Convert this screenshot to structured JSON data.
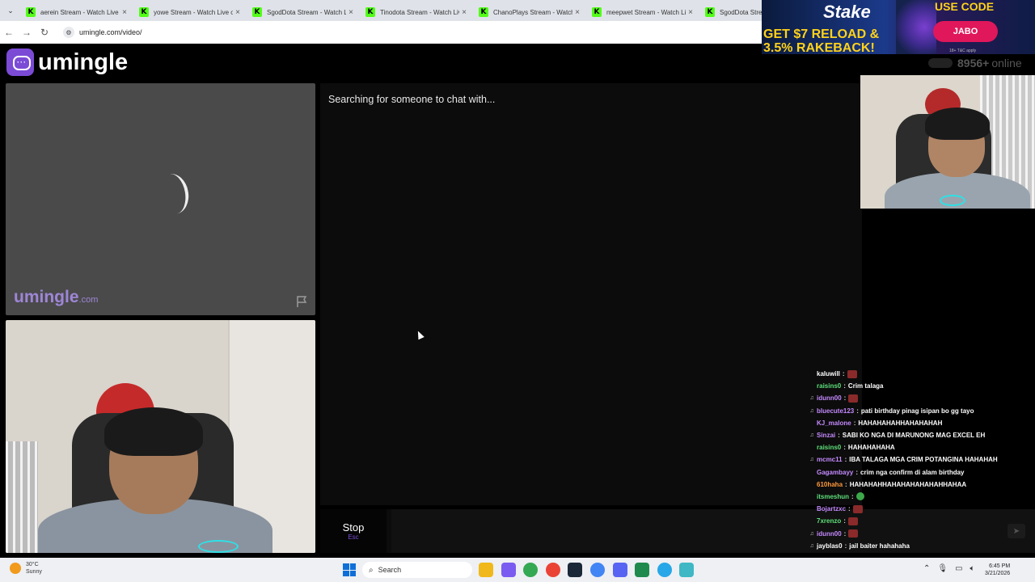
{
  "browser": {
    "tabs": [
      {
        "title": "aerein Stream - Watch Live o"
      },
      {
        "title": "yowe Stream - Watch Live on"
      },
      {
        "title": "SgodDota Stream - Watch Li"
      },
      {
        "title": "Tinodota Stream - Watch Liv"
      },
      {
        "title": "ChanoPlays Stream - Watch"
      },
      {
        "title": "meepwet Stream - Watch Li"
      },
      {
        "title": "SgodDota Stream"
      }
    ],
    "url": "umingle.com/video/"
  },
  "ad": {
    "brand": "Stake",
    "headline_1": "GET $7 RELOAD &",
    "headline_2": "3.5% RAKEBACK!",
    "use_code_label": "USE CODE",
    "code": "JABO",
    "fine_print": "18+ T&C apply"
  },
  "header": {
    "logo_text": "umingle",
    "online_count": "8956+",
    "online_label": "online"
  },
  "stranger_panel": {
    "watermark": "umingle",
    "watermark_suffix": ".com"
  },
  "chat": {
    "status": "Searching for someone to chat with...",
    "stop_label": "Stop",
    "stop_key": "Esc"
  },
  "stream_chat": [
    {
      "user": "kaluwill",
      "color": "#ffffff",
      "message": "",
      "emote": "red",
      "badge": ""
    },
    {
      "user": "raisins0",
      "color": "#5ee07a",
      "message": "Crim talaga",
      "emote": "",
      "badge": ""
    },
    {
      "user": "idunn00",
      "color": "#c58aff",
      "message": "",
      "emote": "red",
      "badge": "♫"
    },
    {
      "user": "bluecute123",
      "color": "#c58aff",
      "message": "pati birthday pinag isipan bo gg tayo",
      "emote": "",
      "badge": "♫"
    },
    {
      "user": "KJ_malone",
      "color": "#c58aff",
      "message": "HAHAHAHAHHAHAHAHAH",
      "emote": "",
      "badge": ""
    },
    {
      "user": "Sinzai",
      "color": "#c58aff",
      "message": "SABI KO NGA DI MARUNONG MAG EXCEL EH",
      "emote": "",
      "badge": "♫"
    },
    {
      "user": "raisins0",
      "color": "#5ee07a",
      "message": "HAHAHAHAHA",
      "emote": "",
      "badge": ""
    },
    {
      "user": "mcmc11",
      "color": "#c58aff",
      "message": "IBA TALAGA MGA CRIM POTANGINA HAHAHAH",
      "emote": "",
      "badge": "♫"
    },
    {
      "user": "Gagambayy",
      "color": "#c58aff",
      "message": "crim nga confirm di alam birthday",
      "emote": "",
      "badge": ""
    },
    {
      "user": "610haha",
      "color": "#ff9a3c",
      "message": "HAHAHAHHAHAHAHAHAHAHHAHAA",
      "emote": "",
      "badge": ""
    },
    {
      "user": "itsmeshun",
      "color": "#5ee07a",
      "message": "",
      "emote": "green",
      "badge": ""
    },
    {
      "user": "Bojartzxc",
      "color": "#c58aff",
      "message": "",
      "emote": "red",
      "badge": ""
    },
    {
      "user": "7xrenzo",
      "color": "#5ee07a",
      "message": "",
      "emote": "red",
      "badge": ""
    },
    {
      "user": "idunn00",
      "color": "#c58aff",
      "message": "",
      "emote": "red",
      "badge": "♫"
    },
    {
      "user": "jayblas0",
      "color": "#ffffff",
      "message": "jail baiter hahahaha",
      "emote": "",
      "badge": "♫"
    }
  ],
  "taskbar": {
    "weather_temp": "30°C",
    "weather_desc": "Sunny",
    "search_placeholder": "Search",
    "time": "6:45 PM",
    "date": "3/21/2026"
  }
}
